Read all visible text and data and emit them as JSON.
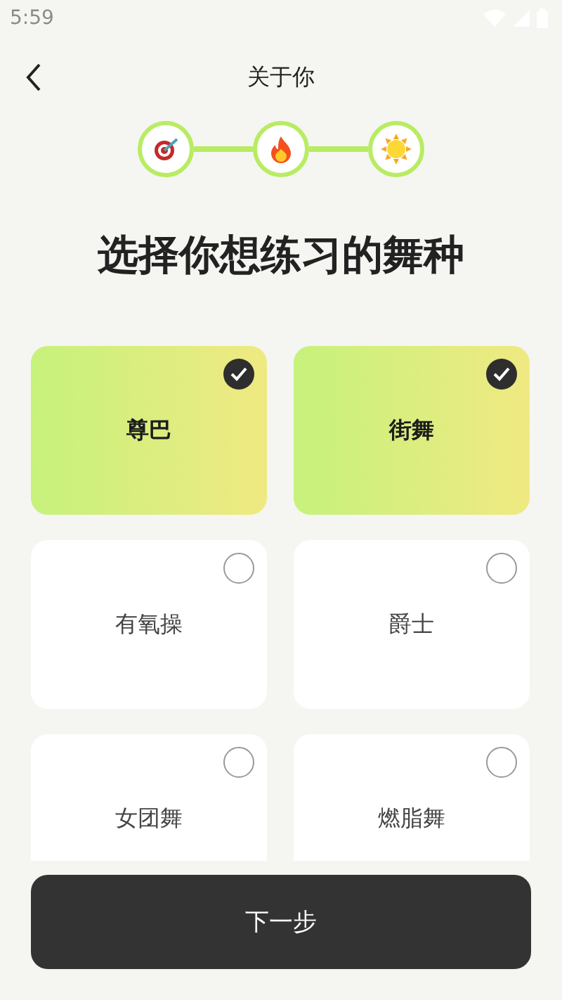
{
  "status_bar": {
    "time": "5:59"
  },
  "header": {
    "title": "关于你"
  },
  "steps": [
    {
      "kind": "target",
      "done": true
    },
    {
      "kind": "flame",
      "done": true
    },
    {
      "kind": "sun",
      "done": true
    }
  ],
  "heading": "选择你想练习的舞种",
  "options": [
    {
      "label": "尊巴",
      "selected": true
    },
    {
      "label": "街舞",
      "selected": true
    },
    {
      "label": "有氧操",
      "selected": false
    },
    {
      "label": "爵士",
      "selected": false
    },
    {
      "label": "女团舞",
      "selected": false
    },
    {
      "label": "燃脂舞",
      "selected": false
    }
  ],
  "next_button": "下一步"
}
